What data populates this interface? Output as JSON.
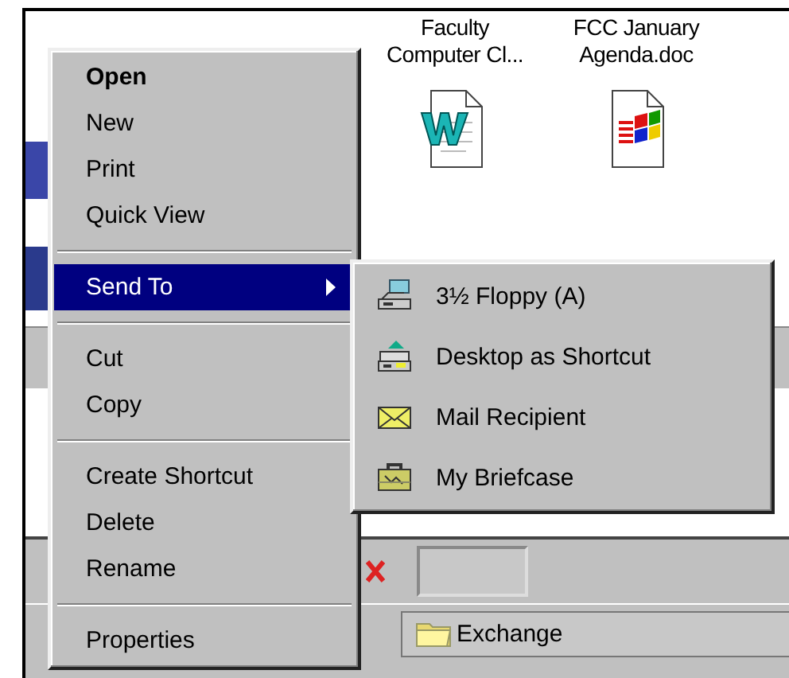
{
  "folder_window": {
    "icons": [
      {
        "label": "Faculty Computer Cl...",
        "kind": "word"
      },
      {
        "label": "FCC January Agenda.doc",
        "kind": "setup"
      }
    ],
    "location": {
      "label": "Exchange"
    }
  },
  "context_menu": {
    "items": [
      {
        "kind": "item",
        "label": "Open",
        "default": true,
        "selected": false,
        "submenu": false
      },
      {
        "kind": "item",
        "label": "New",
        "default": false,
        "selected": false,
        "submenu": false
      },
      {
        "kind": "item",
        "label": "Print",
        "default": false,
        "selected": false,
        "submenu": false
      },
      {
        "kind": "item",
        "label": "Quick View",
        "default": false,
        "selected": false,
        "submenu": false
      },
      {
        "kind": "separator"
      },
      {
        "kind": "item",
        "label": "Send To",
        "default": false,
        "selected": true,
        "submenu": true
      },
      {
        "kind": "separator"
      },
      {
        "kind": "item",
        "label": "Cut",
        "default": false,
        "selected": false,
        "submenu": false
      },
      {
        "kind": "item",
        "label": "Copy",
        "default": false,
        "selected": false,
        "submenu": false
      },
      {
        "kind": "separator"
      },
      {
        "kind": "item",
        "label": "Create Shortcut",
        "default": false,
        "selected": false,
        "submenu": false
      },
      {
        "kind": "item",
        "label": "Delete",
        "default": false,
        "selected": false,
        "submenu": false
      },
      {
        "kind": "item",
        "label": "Rename",
        "default": false,
        "selected": false,
        "submenu": false
      },
      {
        "kind": "separator"
      },
      {
        "kind": "item",
        "label": "Properties",
        "default": false,
        "selected": false,
        "submenu": false
      }
    ]
  },
  "send_to_menu": {
    "items": [
      {
        "kind": "floppy",
        "label": "3½ Floppy (A)",
        "selected": false
      },
      {
        "kind": "desktop",
        "label": "Desktop as Shortcut",
        "selected": false
      },
      {
        "kind": "mail",
        "label": "Mail Recipient",
        "selected": false
      },
      {
        "kind": "briefcase",
        "label": "My Briefcase",
        "selected": false
      }
    ]
  }
}
